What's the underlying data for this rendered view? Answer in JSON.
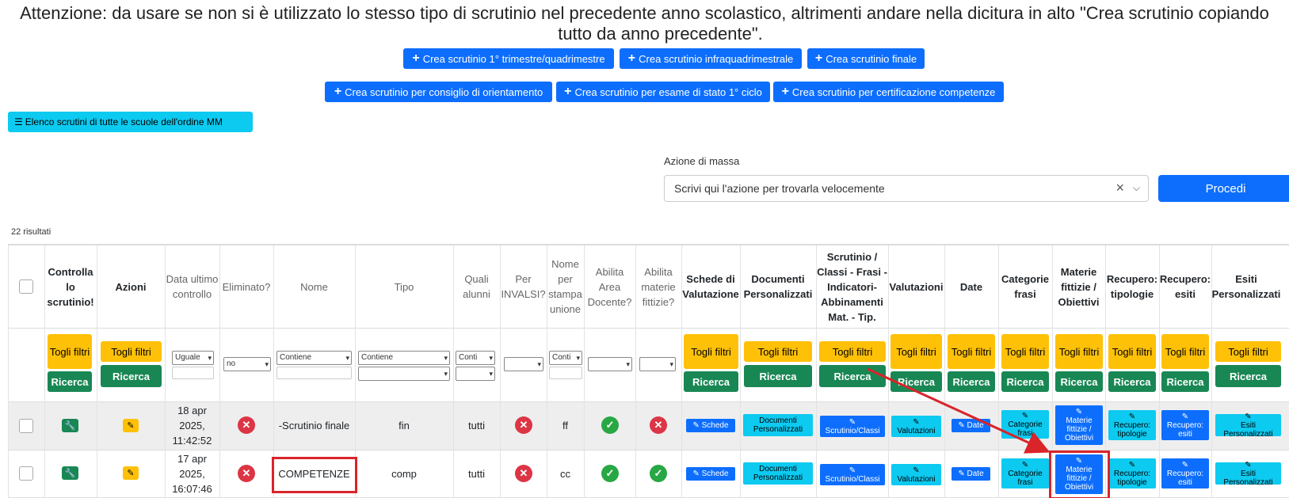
{
  "notice": {
    "line1": "Attenzione: da usare se non si è utilizzato lo stesso tipo di scrutinio nel precedente anno scolastico, altrimenti andare nella dicitura in alto \"Crea scrutinio copiando",
    "line2": "tutto da anno precedente\"."
  },
  "create_buttons": [
    "Crea scrutinio 1° trimestre/quadrimestre",
    "Crea scrutinio infraquadrimestrale",
    "Crea scrutinio finale",
    "Crea scrutinio per consiglio di orientamento",
    "Crea scrutinio per esame di stato 1° ciclo",
    "Crea scrutinio per certificazione competenze"
  ],
  "elenco_button": "Elenco scrutini di tutte le scuole dell'ordine MM",
  "mass_action": {
    "label": "Azione di massa",
    "placeholder": "Scrivi qui l'azione per trovarla velocemente",
    "procedi": "Procedi"
  },
  "results_count": "22 risultati",
  "headers": {
    "controlla": "Controlla lo scrutinio!",
    "azioni": "Azioni",
    "data": "Data ultimo controllo",
    "eliminato": "Eliminato?",
    "nome": "Nome",
    "tipo": "Tipo",
    "quali": "Quali alunni",
    "invalsi": "Per INVALSI?",
    "nome_stampa": "Nome per stampa unione",
    "area_docente": "Abilita Area Docente?",
    "materie_fittizie": "Abilita materie fittizie?",
    "schede": "Schede di Valutazione",
    "documenti": "Documenti Personalizzati",
    "scrutinio_classi": "Scrutinio / Classi - Frasi - Indicatori- Abbinamenti Mat. - Tip.",
    "valutazioni": "Valutazioni",
    "date": "Date",
    "categorie": "Categorie frasi",
    "materie": "Materie fittizie / Obiettivi",
    "rec_tip": "Recupero: tipologie",
    "rec_esiti": "Recupero: esiti",
    "esiti": "Esiti Personalizzati"
  },
  "filters": {
    "togli": "Togli filtri",
    "ricerca": "Ricerca",
    "uguale": "Uguale",
    "no": "no",
    "contiene": "Contiene",
    "conti": "Conti"
  },
  "rows": [
    {
      "data": "18 apr 2025, 11:42:52",
      "nome": "-Scrutinio finale",
      "tipo": "fin",
      "quali": "tutti",
      "nome_stampa": "ff",
      "area_docente": "yes",
      "materie_fittizie": "no"
    },
    {
      "data": "17 apr 2025, 16:07:46",
      "nome": "COMPETENZE",
      "tipo": "comp",
      "quali": "tutti",
      "nome_stampa": "cc",
      "area_docente": "yes",
      "materie_fittizie": "yes"
    }
  ],
  "row_buttons": {
    "schede": "Schede",
    "documenti": "Documenti Personalizzati",
    "scrutinio": "Scrutinio/Classi",
    "valutazioni": "Valutazioni",
    "date": "Date",
    "categorie": "Categorie frasi",
    "materie": "Materie fittizie / Obiettivi",
    "rec_tip": "Recupero: tipologie",
    "rec_esiti": "Recupero: esiti",
    "esiti": "Esiti Personalizzati"
  },
  "colors": {
    "primary": "#0d6efd",
    "info": "#0dcaf0",
    "warning": "#ffc107",
    "success": "#198754",
    "danger": "#dc3545",
    "annotation": "#d9242a"
  }
}
